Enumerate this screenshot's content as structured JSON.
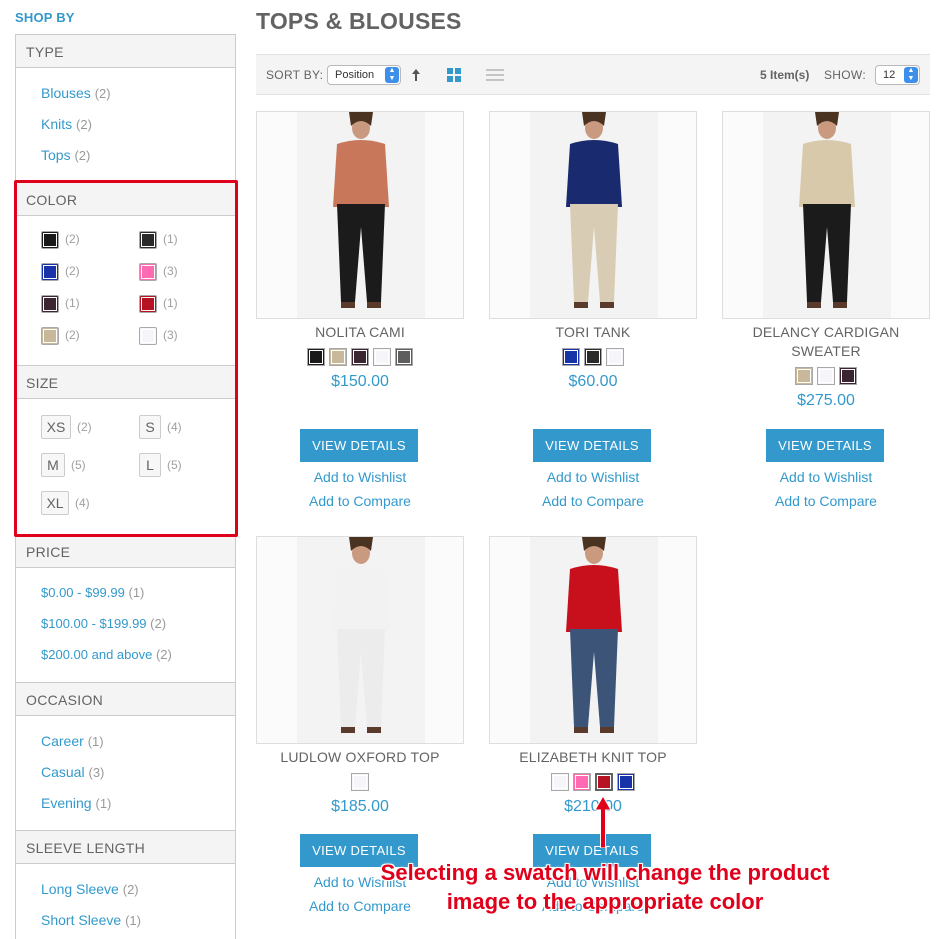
{
  "sidebar": {
    "shop_by": "SHOP BY",
    "type": {
      "title": "TYPE",
      "items": [
        {
          "label": "Blouses",
          "count": "(2)"
        },
        {
          "label": "Knits",
          "count": "(2)"
        },
        {
          "label": "Tops",
          "count": "(2)"
        }
      ]
    },
    "color": {
      "title": "COLOR",
      "swatches": [
        {
          "color": "#1a1a1a",
          "count": "(2)"
        },
        {
          "color": "#2a2a2a",
          "count": "(1)"
        },
        {
          "color": "#1832a8",
          "count": "(2)"
        },
        {
          "color": "#ff6ab0",
          "count": "(3)"
        },
        {
          "color": "#3b2530",
          "count": "(1)"
        },
        {
          "color": "#b51223",
          "count": "(1)"
        },
        {
          "color": "#c8b89c",
          "count": "(2)"
        },
        {
          "color": "#f5f5fa",
          "count": "(3)"
        }
      ]
    },
    "size": {
      "title": "SIZE",
      "items": [
        {
          "label": "XS",
          "count": "(2)"
        },
        {
          "label": "S",
          "count": "(4)"
        },
        {
          "label": "M",
          "count": "(5)"
        },
        {
          "label": "L",
          "count": "(5)"
        },
        {
          "label": "XL",
          "count": "(4)"
        }
      ]
    },
    "price": {
      "title": "PRICE",
      "items": [
        {
          "label": "$0.00 - $99.99",
          "count": "(1)"
        },
        {
          "label": "$100.00 - $199.99",
          "count": "(2)"
        },
        {
          "label": "$200.00 and above",
          "count": "(2)"
        }
      ]
    },
    "occasion": {
      "title": "OCCASION",
      "items": [
        {
          "label": "Career",
          "count": "(1)"
        },
        {
          "label": "Casual",
          "count": "(3)"
        },
        {
          "label": "Evening",
          "count": "(1)"
        }
      ]
    },
    "sleeve": {
      "title": "SLEEVE LENGTH",
      "items": [
        {
          "label": "Long Sleeve",
          "count": "(2)"
        },
        {
          "label": "Short Sleeve",
          "count": "(1)"
        }
      ]
    }
  },
  "main": {
    "title": "TOPS & BLOUSES",
    "toolbar": {
      "sort_label": "SORT BY:",
      "sort_value": "Position",
      "items_count": "5 Item(s)",
      "show_label": "SHOW:",
      "show_value": "12"
    },
    "products": [
      {
        "name": "NOLITA CAMI",
        "price": "$150.00",
        "swatches": [
          "#1a1a1a",
          "#c8b89c",
          "#3b2530",
          "#f5f5fa",
          "#5e5e5e"
        ],
        "selected": -1,
        "top_color": "#c9775a",
        "bottom_color": "#1b1b1b"
      },
      {
        "name": "TORI TANK",
        "price": "$60.00",
        "swatches": [
          "#1832a8",
          "#2a2a2a",
          "#f5f5fa"
        ],
        "selected": -1,
        "top_color": "#1a2a6e",
        "bottom_color": "#d8cdb4"
      },
      {
        "name": "DELANCY CARDIGAN SWEATER",
        "price": "$275.00",
        "swatches": [
          "#c8b89c",
          "#f5f5fa",
          "#3b2530"
        ],
        "selected": -1,
        "top_color": "#d8c9ab",
        "bottom_color": "#1b1b1b"
      },
      {
        "name": "LUDLOW OXFORD TOP",
        "price": "$185.00",
        "swatches": [
          "#f5f5fa"
        ],
        "selected": -1,
        "top_color": "#f2f2f2",
        "bottom_color": "#ececec"
      },
      {
        "name": "ELIZABETH KNIT TOP",
        "price": "$210.00",
        "swatches": [
          "#f5f5fa",
          "#ff6ab0",
          "#b51223",
          "#1832a8"
        ],
        "selected": 2,
        "top_color": "#c8101c",
        "bottom_color": "#3d5479"
      }
    ],
    "view_details": "VIEW DETAILS",
    "add_wishlist": "Add to Wishlist",
    "add_compare": "Add to Compare"
  },
  "annotation": {
    "line1": "Selecting a swatch will change the product",
    "line2": "image to the appropriate color",
    "color": "#e0001b"
  },
  "icons": [
    "sort-ascending-icon",
    "grid-view-icon",
    "list-view-icon",
    "select-arrows-icon",
    "annotation-arrow-icon"
  ]
}
